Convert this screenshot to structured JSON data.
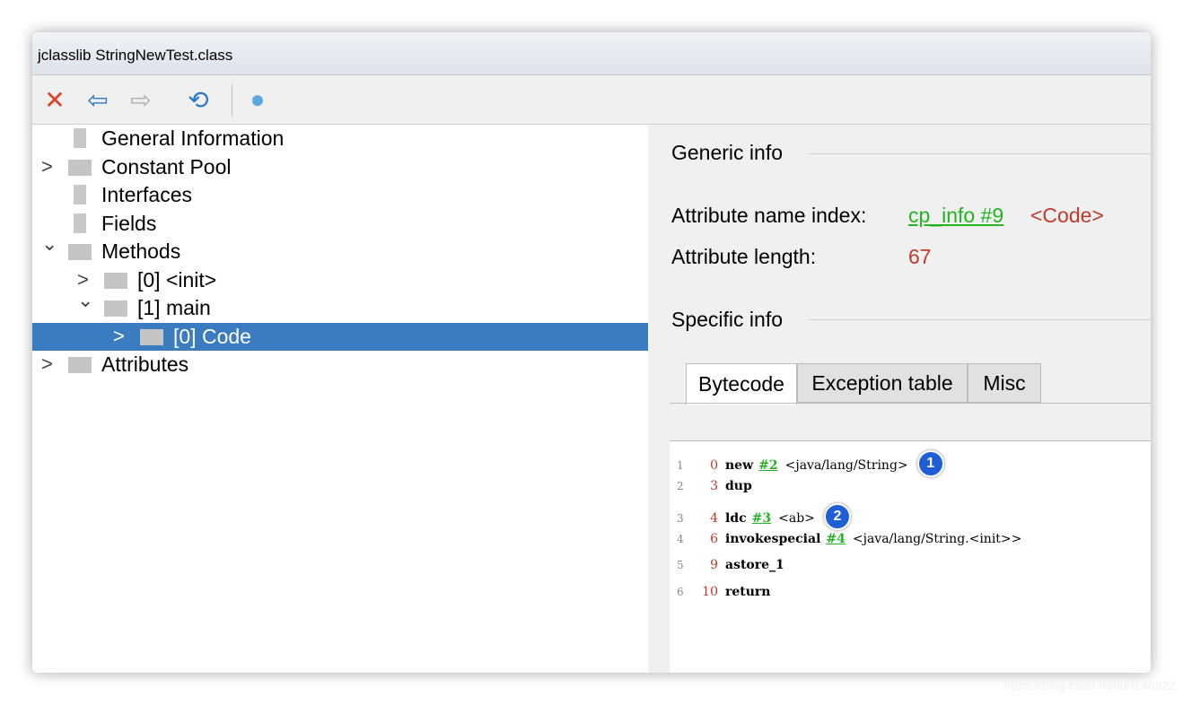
{
  "window": {
    "title": "jclasslib StringNewTest.class"
  },
  "toolbar": {
    "buttons": [
      {
        "name": "close",
        "icon": "close-icon",
        "glyph": "✕",
        "color": "#e04020"
      },
      {
        "name": "back",
        "icon": "arrow-left-icon",
        "glyph": "⇦",
        "color": "#2b79c9"
      },
      {
        "name": "forward",
        "icon": "arrow-right-icon",
        "glyph": "⇨",
        "color": "#b0b0b0"
      },
      {
        "name": "reload",
        "icon": "reload-icon",
        "glyph": "⟲",
        "color": "#2b79c9"
      },
      {
        "name": "web",
        "icon": "globe-icon",
        "glyph": "●",
        "color": "#5ea8e0"
      }
    ]
  },
  "tree": {
    "items": [
      {
        "label": "General Information",
        "arrow": "",
        "icon": "file",
        "depth": 0
      },
      {
        "label": "Constant Pool",
        "arrow": "›",
        "icon": "folder",
        "depth": 0
      },
      {
        "label": "Interfaces",
        "arrow": "",
        "icon": "file",
        "depth": 0
      },
      {
        "label": "Fields",
        "arrow": "",
        "icon": "file",
        "depth": 0
      },
      {
        "label": "Methods",
        "arrow": "⌄",
        "icon": "folder",
        "depth": 0
      },
      {
        "label": "[0] <init>",
        "arrow": "›",
        "icon": "folder",
        "depth": 1
      },
      {
        "label": "[1] main",
        "arrow": "⌄",
        "icon": "folder",
        "depth": 1
      },
      {
        "label": "[0] Code",
        "arrow": "›",
        "icon": "folder",
        "depth": 2,
        "selected": true
      },
      {
        "label": "Attributes",
        "arrow": "›",
        "icon": "folder",
        "depth": 0
      }
    ]
  },
  "generic": {
    "heading": "Generic info",
    "name_index_label": "Attribute name index:",
    "name_index_link": "cp_info #9",
    "name_index_value": "<Code>",
    "length_label": "Attribute length:",
    "length_value": "67"
  },
  "specific": {
    "heading": "Specific info",
    "tabs": [
      "Bytecode",
      "Exception table",
      "Misc"
    ],
    "active_tab": "Bytecode"
  },
  "bytecode": [
    {
      "line": "1",
      "pc": "0",
      "op": "new",
      "ref": "#2",
      "comment": "<java/lang/String>",
      "badge": "1"
    },
    {
      "line": "2",
      "pc": "3",
      "op": "dup",
      "ref": "",
      "comment": "",
      "badge": ""
    },
    {
      "line": "3",
      "pc": "4",
      "op": "ldc",
      "ref": "#3",
      "comment": "<ab>",
      "badge": "2"
    },
    {
      "line": "4",
      "pc": "6",
      "op": "invokespecial",
      "ref": "#4",
      "comment": "<java/lang/String.<init>>",
      "badge": ""
    },
    {
      "line": "5",
      "pc": "9",
      "op": "astore_1",
      "ref": "",
      "comment": "",
      "badge": ""
    },
    {
      "line": "6",
      "pc": "10",
      "op": "return",
      "ref": "",
      "comment": "",
      "badge": ""
    }
  ],
  "watermark": "https://blog.csdn.net/u0146922",
  "colors": {
    "selection": "#3b7cc1",
    "link": "#23b323",
    "value_red": "#c0392b",
    "badge": "#1f5fd6"
  }
}
